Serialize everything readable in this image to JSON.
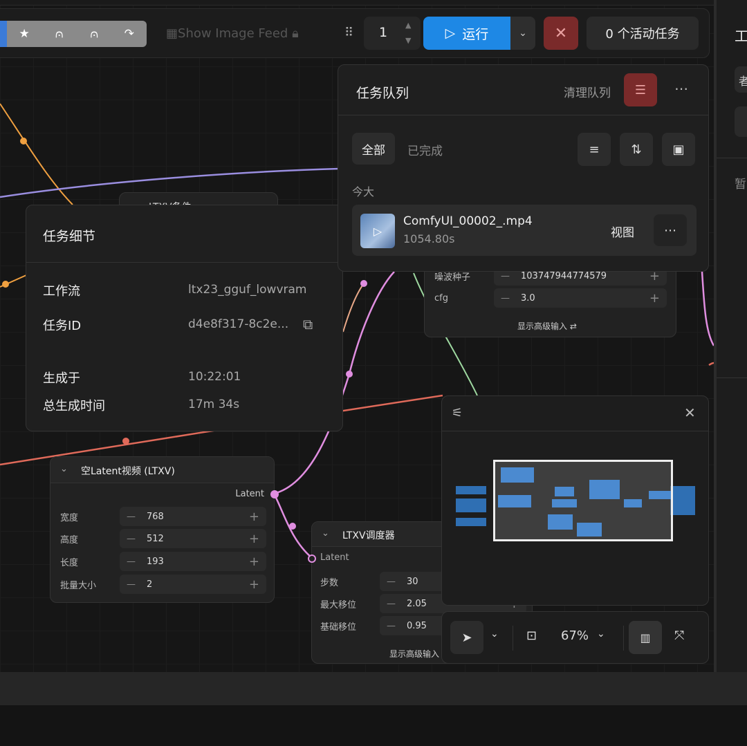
{
  "toolbar": {
    "tool_icons": [
      "star-icon",
      "bridge-icon",
      "bridge-icon",
      "redo-icon"
    ],
    "show_image_feed": "Show Image Feed",
    "batch_count": "1",
    "run_label": "运行",
    "active_tasks": "0 个活动任务"
  },
  "right_panel": {
    "title": "工",
    "chip": "者",
    "text": "暂"
  },
  "task_detail": {
    "title": "任务细节",
    "workflow_label": "工作流",
    "workflow_value": "ltx23_gguf_lowvram",
    "task_id_label": "任务ID",
    "task_id_value": "d4e8f317-8c2e...",
    "generated_at_label": "生成于",
    "generated_at_value": "10:22:01",
    "total_time_label": "总生成时间",
    "total_time_value": "17m 34s"
  },
  "queue": {
    "title": "任务队列",
    "clear_label": "清理队列",
    "tab_all": "全部",
    "tab_completed": "已完成",
    "today": "今大",
    "items": [
      {
        "filename": "ComfyUI_00002_.mp4",
        "duration": "1054.80s",
        "view_label": "视图"
      }
    ]
  },
  "nodes": {
    "ltxv_cond_partial": "LTXV条件",
    "sampler_partial": {
      "seed_label": "噪波种子",
      "seed_value": "103747944774579",
      "cfg_label": "cfg",
      "cfg_value": "3.0",
      "show_advanced": "显示高级输入"
    },
    "empty_latent": {
      "title": "空Latent视频 (LTXV)",
      "output": "Latent",
      "rows": [
        {
          "label": "宽度",
          "value": "768"
        },
        {
          "label": "高度",
          "value": "512"
        },
        {
          "label": "长度",
          "value": "193"
        },
        {
          "label": "批量大小",
          "value": "2"
        }
      ]
    },
    "scheduler": {
      "title": "LTXV调度器",
      "input": "Latent",
      "rows": [
        {
          "label": "步数",
          "value": "30"
        },
        {
          "label": "最大移位",
          "value": "2.05"
        },
        {
          "label": "基础移位",
          "value": "0.95"
        }
      ],
      "show_advanced": "显示高级输入"
    }
  },
  "zoom": {
    "level": "67%"
  },
  "colors": {
    "accent": "#1e88e5",
    "danger": "#7a2a2a",
    "wire_orange": "#f0a040",
    "wire_purple": "#9a8ee0",
    "wire_pink": "#e08ee0",
    "wire_red": "#e06a5a",
    "wire_green": "#9ed8a0"
  }
}
